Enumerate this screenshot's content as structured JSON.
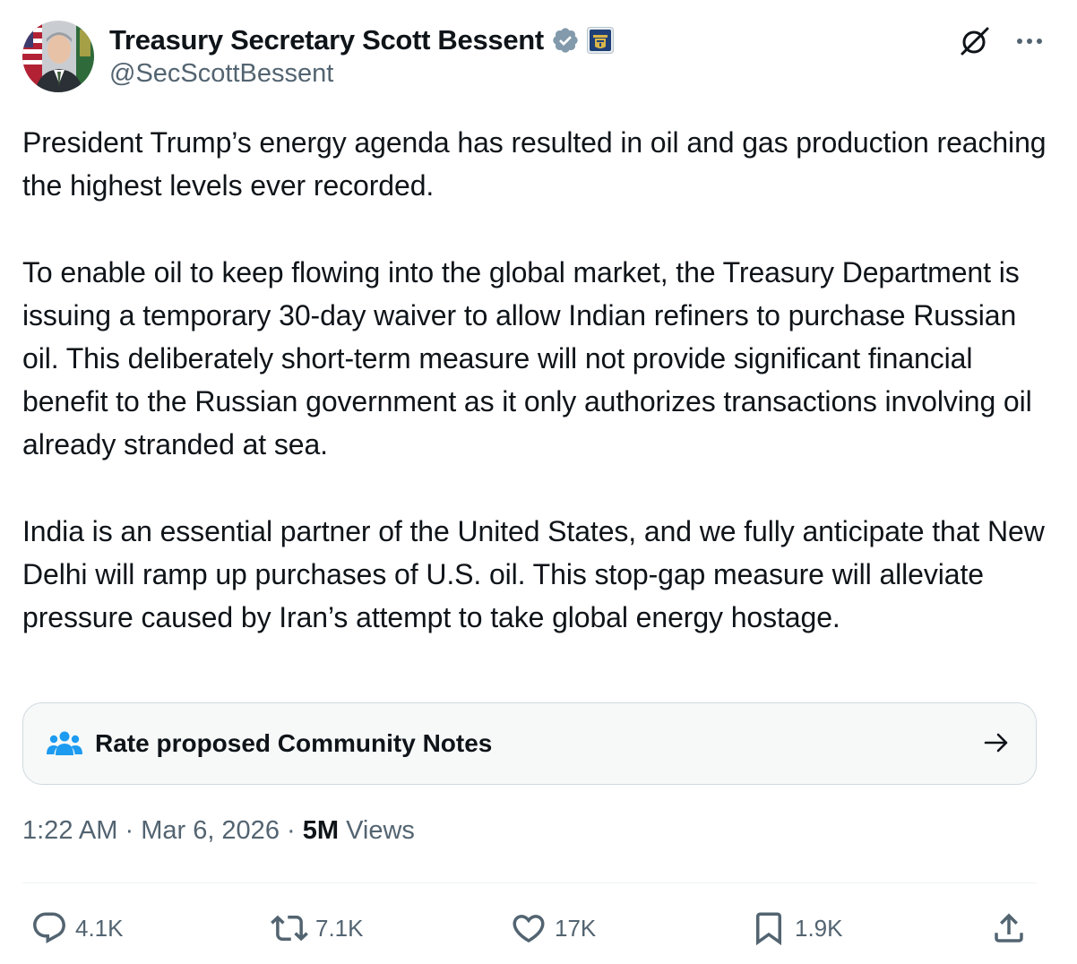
{
  "author": {
    "display_name": "Treasury Secretary Scott Bessent",
    "handle": "@SecScottBessent"
  },
  "icons": {
    "verified": "verified-badge-icon",
    "affiliate": "treasury-seal-icon",
    "grok": "grok-icon",
    "more": "more-options-icon",
    "community_notes": "community-people-icon",
    "arrow": "arrow-right-icon",
    "reply": "reply-icon",
    "repost": "repost-icon",
    "like": "like-icon",
    "bookmark": "bookmark-icon",
    "share": "share-icon"
  },
  "colors": {
    "text": "#0f1419",
    "secondary": "#536471",
    "verified_badge": "#829aab",
    "notes_icon": "#1d9bf0",
    "notes_bg": "#f7f9f9",
    "border": "#cfd9de"
  },
  "tweet": {
    "paragraphs": [
      "President Trump’s energy agenda has resulted in oil and gas production reaching the highest levels ever recorded.",
      "To enable oil to keep flowing into the global market, the Treasury Department is issuing a temporary 30-day waiver to allow Indian refiners to purchase Russian oil. This deliberately short-term measure will not provide significant financial benefit to the Russian government as it only authorizes transactions involving oil already stranded at sea.",
      "India is an essential partner of the United States, and we fully anticipate that New Delhi will ramp up purchases of U.S. oil. This stop-gap measure will alleviate pressure caused by Iran’s attempt to take global energy hostage."
    ]
  },
  "community_notes": {
    "label": "Rate proposed Community Notes"
  },
  "meta": {
    "time": "1:22 AM",
    "separator": " · ",
    "date": "Mar 6, 2026",
    "views_count": "5M",
    "views_label": " Views"
  },
  "actions": {
    "replies": "4.1K",
    "reposts": "7.1K",
    "likes": "17K",
    "bookmarks": "1.9K"
  }
}
